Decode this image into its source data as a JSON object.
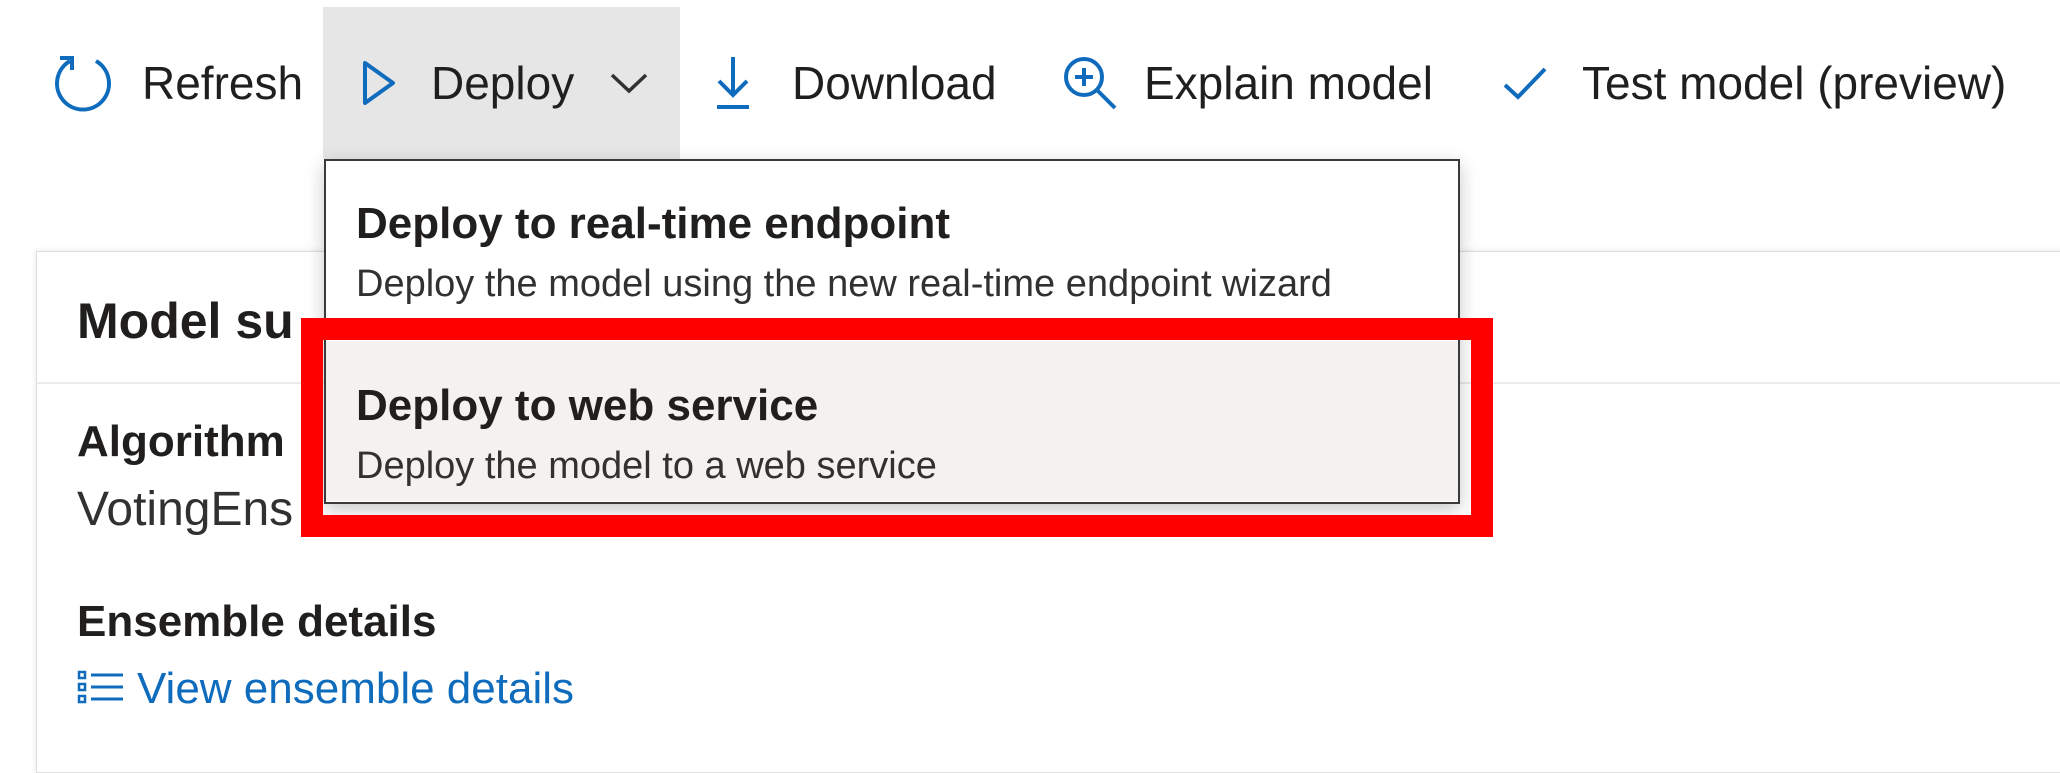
{
  "toolbar": {
    "refresh": {
      "label": "Refresh",
      "icon": "refresh-icon"
    },
    "deploy": {
      "label": "Deploy",
      "icon": "play-icon",
      "chevron": "chevron-down-icon"
    },
    "download": {
      "label": "Download",
      "icon": "download-icon"
    },
    "explain": {
      "label": "Explain model",
      "icon": "zoom-in-icon"
    },
    "test": {
      "label": "Test model (preview)",
      "icon": "checkmark-icon"
    }
  },
  "deploy_menu": {
    "items": [
      {
        "title": "Deploy to real-time endpoint",
        "description": "Deploy the model using the new real-time endpoint wizard"
      },
      {
        "title": "Deploy to web service",
        "description": "Deploy the model to a web service"
      }
    ]
  },
  "card": {
    "title": "Model su",
    "algorithm_label": "Algorithm",
    "algorithm_value": "VotingEns",
    "ensemble_label": "Ensemble details",
    "ensemble_link": "View ensemble details"
  },
  "colors": {
    "accent": "#0f6cbd",
    "highlight": "#ff0000",
    "active_button_bg": "#e6e6e6",
    "hover_item_bg": "#f3f2f1"
  }
}
